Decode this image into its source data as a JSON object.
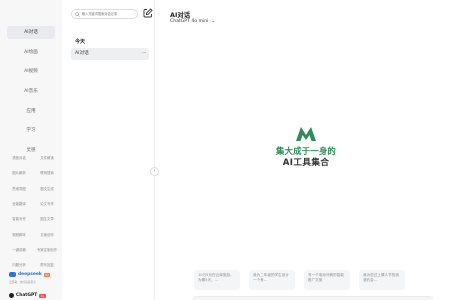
{
  "nav": {
    "items": [
      {
        "label": "AI对话",
        "active": true
      },
      {
        "label": "AI绘画",
        "active": false
      },
      {
        "label": "AI视频",
        "active": false
      },
      {
        "label": "AI音乐",
        "active": false
      },
      {
        "label": "应用",
        "active": false
      },
      {
        "label": "学习",
        "active": false
      },
      {
        "label": "灵感",
        "active": false
      }
    ],
    "tools": [
      [
        "语音对话",
        "文件解读"
      ],
      [
        "图片解析",
        "联网搜索"
      ],
      [
        "思维导图",
        "图文生成"
      ],
      [
        "全能翻译",
        "论文写作"
      ],
      [
        "智能写作",
        "图生文章"
      ],
      [
        "视频脚本",
        "文案创作"
      ],
      [
        "一键成稿",
        "专家定制创作"
      ],
      [
        "问题分析",
        "帮写回复"
      ]
    ],
    "logo1": {
      "text": "deepseek",
      "badge": "R1",
      "subtext": "云部署，支持深度思考"
    },
    "logo2": {
      "text": "ChatGPT",
      "badge": "4o"
    }
  },
  "history": {
    "search_placeholder": "输入关键词搜索对话记录",
    "section": "今天",
    "conversations": [
      {
        "title": "AI对话",
        "more": "···"
      }
    ],
    "collapse_glyph": "‹"
  },
  "main": {
    "title": "AI对话",
    "model": "ChatGPT 4o mini",
    "model_chevron": "⌄",
    "tagline1": "集大成于一身的",
    "tagline2": "AI工具集合",
    "prompt_cards": [
      "10万5月在云南旅游，为期5天，...",
      "我为二年级的学生设计一个有...",
      "写一个电动牙刷的智能推广文案",
      "我为您过上情人节的浪漫约会..."
    ]
  },
  "colors": {
    "accent": "#2d8c5a",
    "nav_active": "#e9eaed",
    "deepseek": "#2f6fe4"
  }
}
